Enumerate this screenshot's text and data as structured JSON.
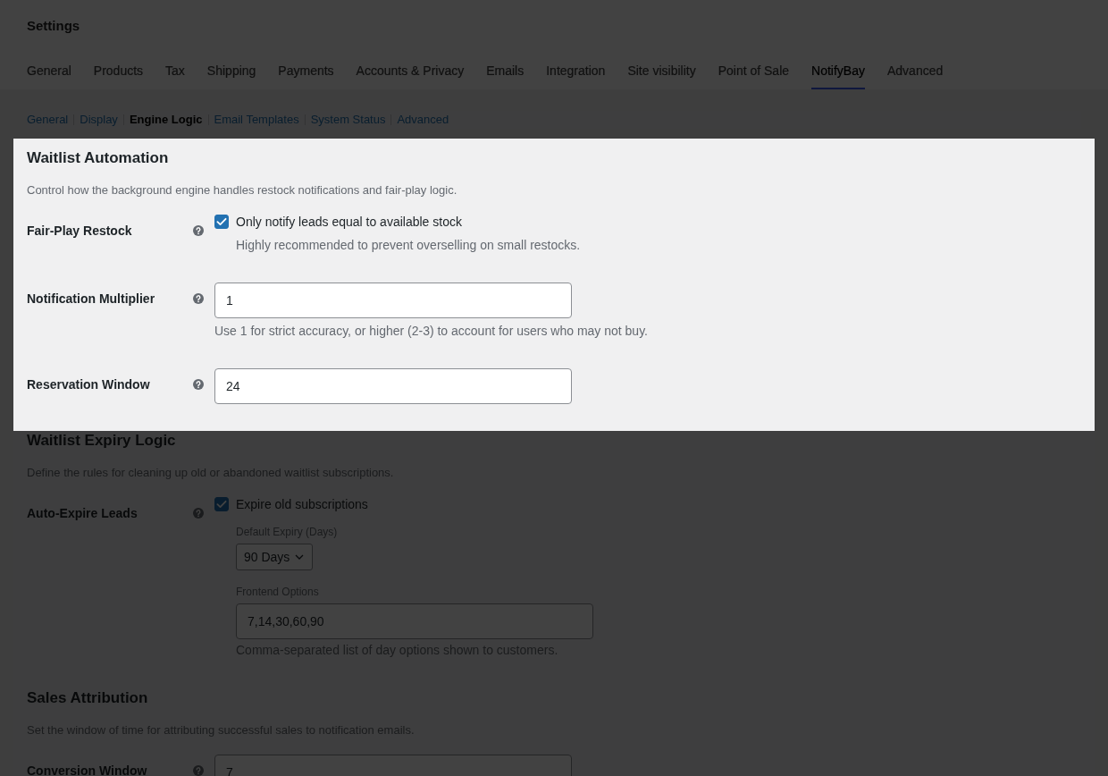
{
  "header": {
    "title": "Settings"
  },
  "tabs": [
    {
      "label": "General",
      "selected": false
    },
    {
      "label": "Products",
      "selected": false
    },
    {
      "label": "Tax",
      "selected": false
    },
    {
      "label": "Shipping",
      "selected": false
    },
    {
      "label": "Payments",
      "selected": false
    },
    {
      "label": "Accounts & Privacy",
      "selected": false
    },
    {
      "label": "Emails",
      "selected": false
    },
    {
      "label": "Integration",
      "selected": false
    },
    {
      "label": "Site visibility",
      "selected": false
    },
    {
      "label": "Point of Sale",
      "selected": false
    },
    {
      "label": "NotifyBay",
      "selected": true
    },
    {
      "label": "Advanced",
      "selected": false
    }
  ],
  "subnav": [
    {
      "label": "General",
      "selected": false
    },
    {
      "label": "Display",
      "selected": false
    },
    {
      "label": "Engine Logic",
      "selected": true
    },
    {
      "label": "Email Templates",
      "selected": false
    },
    {
      "label": "System Status",
      "selected": false
    },
    {
      "label": "Advanced",
      "selected": false
    }
  ],
  "sections": [
    {
      "title": "Waitlist Automation",
      "description": "Control how the background engine handles restock notifications and fair-play logic.",
      "highlighted": true,
      "rows": [
        {
          "kind": "checkbox",
          "label": "Fair-Play Restock",
          "option_label": "Only notify leads equal to available stock",
          "checked": true,
          "description": "Highly recommended to prevent overselling on small restocks."
        },
        {
          "kind": "input",
          "label": "Notification Multiplier",
          "value": "1",
          "description": "Use 1 for strict accuracy, or higher (2-3) to account for users who may not buy."
        },
        {
          "kind": "input",
          "label": "Reservation Window",
          "value": "24"
        }
      ]
    },
    {
      "title": "Waitlist Expiry Logic",
      "description": "Define the rules for cleaning up old or abandoned waitlist subscriptions.",
      "highlighted": false,
      "rows": [
        {
          "kind": "checkbox",
          "label": "Auto-Expire Leads",
          "option_label": "Expire old subscriptions",
          "checked": true,
          "fields": [
            {
              "kind": "select",
              "label": "Default Expiry (Days)",
              "value": "90 Days"
            },
            {
              "kind": "input",
              "label": "Frontend Options",
              "value": "7,14,30,60,90",
              "description": "Comma-separated list of day options shown to customers."
            }
          ]
        }
      ]
    },
    {
      "title": "Sales Attribution",
      "description": "Set the window of time for attributing successful sales to notification emails.",
      "highlighted": false,
      "rows": [
        {
          "kind": "input",
          "label": "Conversion Window",
          "value": "7"
        }
      ]
    }
  ]
}
